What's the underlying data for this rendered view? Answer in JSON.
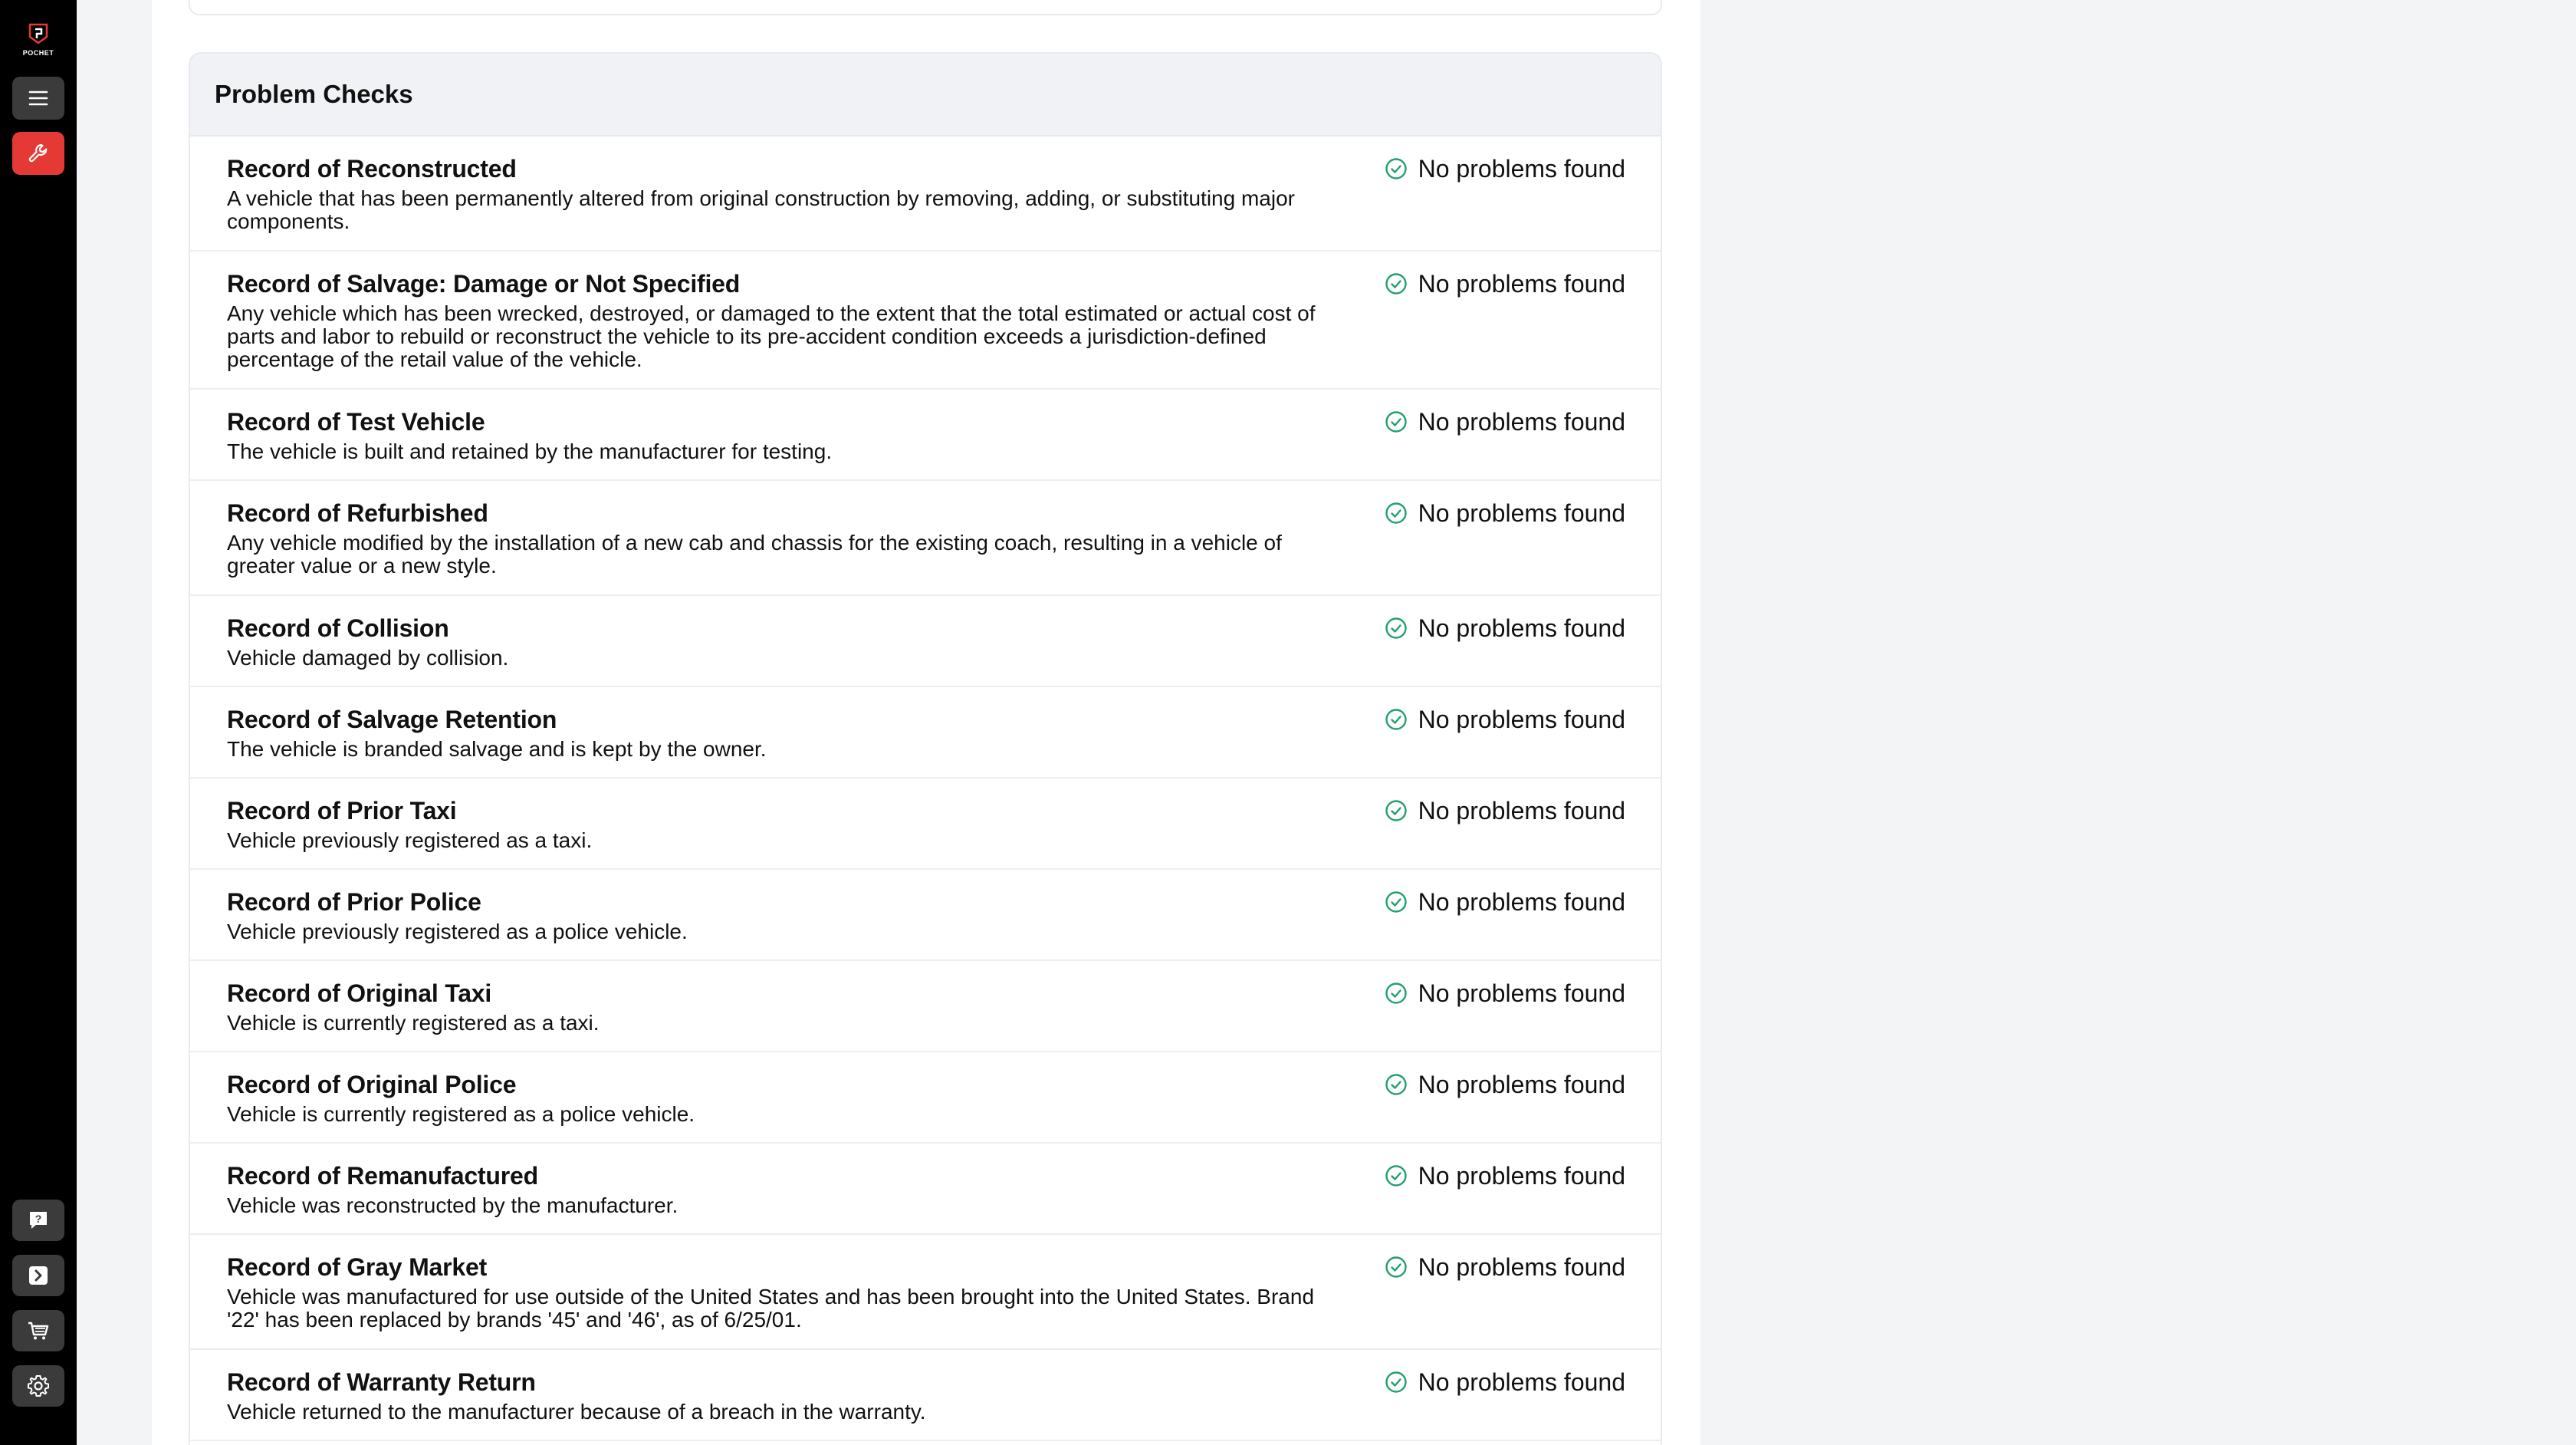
{
  "brand": {
    "logo_text": "POCHET",
    "accent": "#e53935"
  },
  "sidebar": {
    "top_items": [
      {
        "name": "menu",
        "icon": "menu-icon"
      },
      {
        "name": "tools",
        "icon": "wrench-icon",
        "active": true
      }
    ],
    "bottom_items": [
      {
        "name": "help",
        "icon": "help-icon"
      },
      {
        "name": "terminal",
        "icon": "terminal-icon"
      },
      {
        "name": "cart",
        "icon": "cart-icon"
      },
      {
        "name": "settings",
        "icon": "gear-icon"
      }
    ]
  },
  "problem_checks": {
    "title": "Problem Checks",
    "status_color": "#22a06b",
    "items": [
      {
        "title": "Record of Reconstructed",
        "description": "A vehicle that has been permanently altered from original construction by removing, adding, or substituting major components.",
        "status": "No problems found"
      },
      {
        "title": "Record of Salvage: Damage or Not Specified",
        "description": "Any vehicle which has been wrecked, destroyed, or damaged to the extent that the total estimated or actual cost of parts and labor to rebuild or reconstruct the vehicle to its pre-accident condition exceeds a jurisdiction-defined percentage of the retail value of the vehicle.",
        "status": "No problems found"
      },
      {
        "title": "Record of Test Vehicle",
        "description": "The vehicle is built and retained by the manufacturer for testing.",
        "status": "No problems found"
      },
      {
        "title": "Record of Refurbished",
        "description": "Any vehicle modified by the installation of a new cab and chassis for the existing coach, resulting in a vehicle of greater value or a new style.",
        "status": "No problems found"
      },
      {
        "title": "Record of Collision",
        "description": "Vehicle damaged by collision.",
        "status": "No problems found"
      },
      {
        "title": "Record of Salvage Retention",
        "description": "The vehicle is branded salvage and is kept by the owner.",
        "status": "No problems found"
      },
      {
        "title": "Record of Prior Taxi",
        "description": "Vehicle previously registered as a taxi.",
        "status": "No problems found"
      },
      {
        "title": "Record of Prior Police",
        "description": "Vehicle previously registered as a police vehicle.",
        "status": "No problems found"
      },
      {
        "title": "Record of Original Taxi",
        "description": "Vehicle is currently registered as a taxi.",
        "status": "No problems found"
      },
      {
        "title": "Record of Original Police",
        "description": "Vehicle is currently registered as a police vehicle.",
        "status": "No problems found"
      },
      {
        "title": "Record of Remanufactured",
        "description": "Vehicle was reconstructed by the manufacturer.",
        "status": "No problems found"
      },
      {
        "title": "Record of Gray Market",
        "description": "Vehicle was manufactured for use outside of the United States and has been brought into the United States. Brand '22' has been replaced by brands '45' and '46', as of 6/25/01.",
        "status": "No problems found"
      },
      {
        "title": "Record of Warranty Return",
        "description": "Vehicle returned to the manufacturer because of a breach in the warranty.",
        "status": "No problems found"
      }
    ]
  }
}
